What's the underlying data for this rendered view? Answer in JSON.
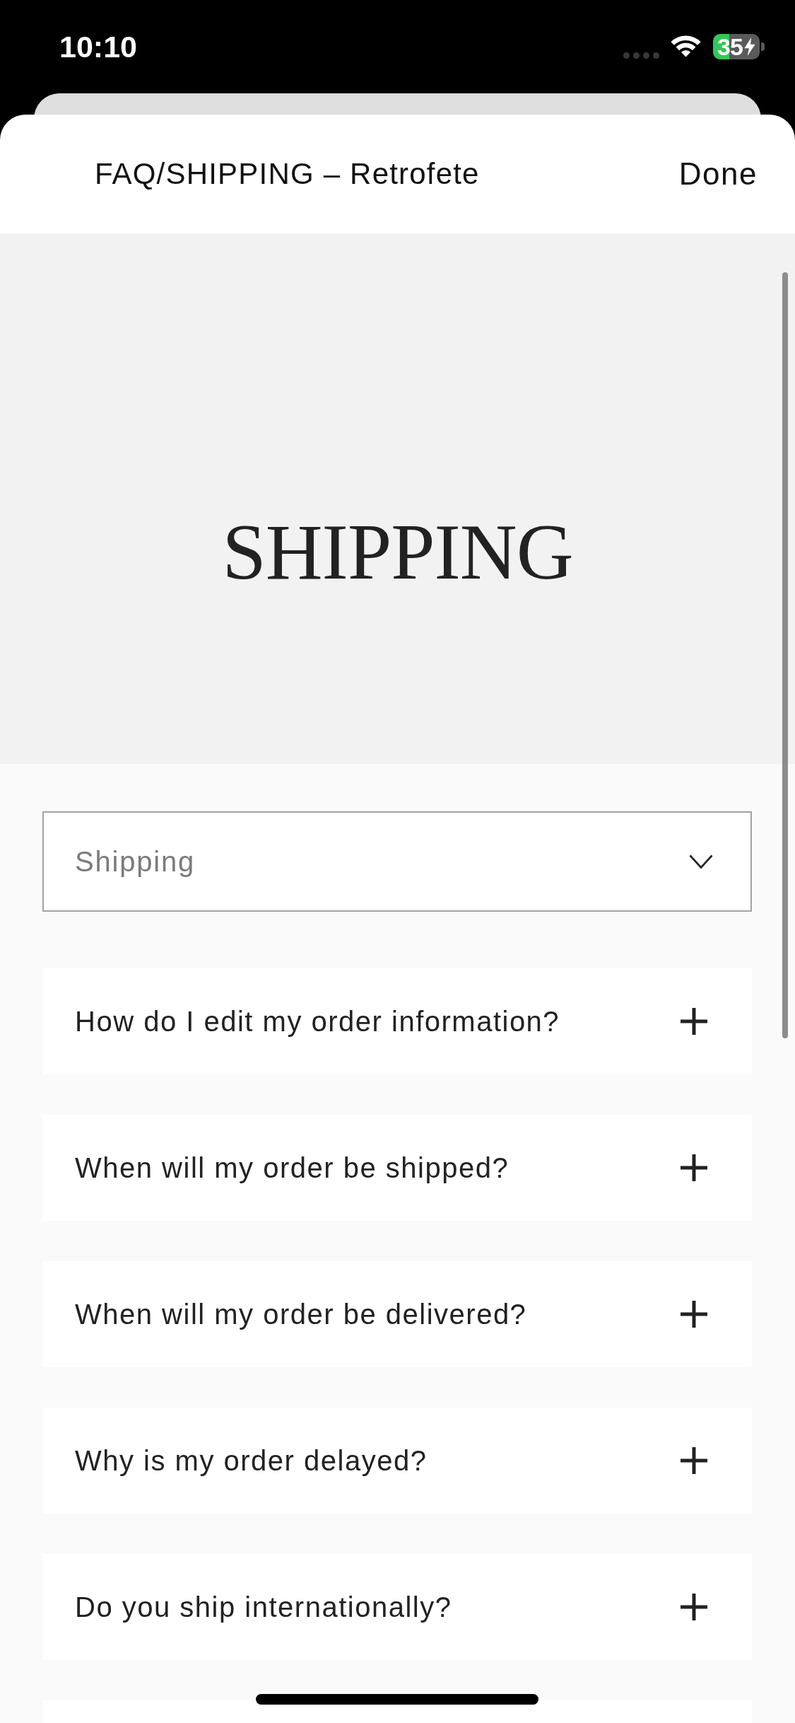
{
  "status_bar": {
    "time": "10:10",
    "battery_percent": "35",
    "charging": true
  },
  "sheet": {
    "title": "FAQ/SHIPPING – Retrofete",
    "done_button": "Done"
  },
  "hero": {
    "title": "SHIPPING"
  },
  "category_select": {
    "value": "Shipping"
  },
  "faq": {
    "items": [
      {
        "question": "How do I edit my order information?",
        "expanded": false
      },
      {
        "question": "When will my order be shipped?",
        "expanded": false
      },
      {
        "question": "When will my order be delivered?",
        "expanded": false
      },
      {
        "question": "Why is my order delayed?",
        "expanded": false
      },
      {
        "question": "Do you ship internationally?",
        "expanded": false
      }
    ],
    "more_below": true
  }
}
